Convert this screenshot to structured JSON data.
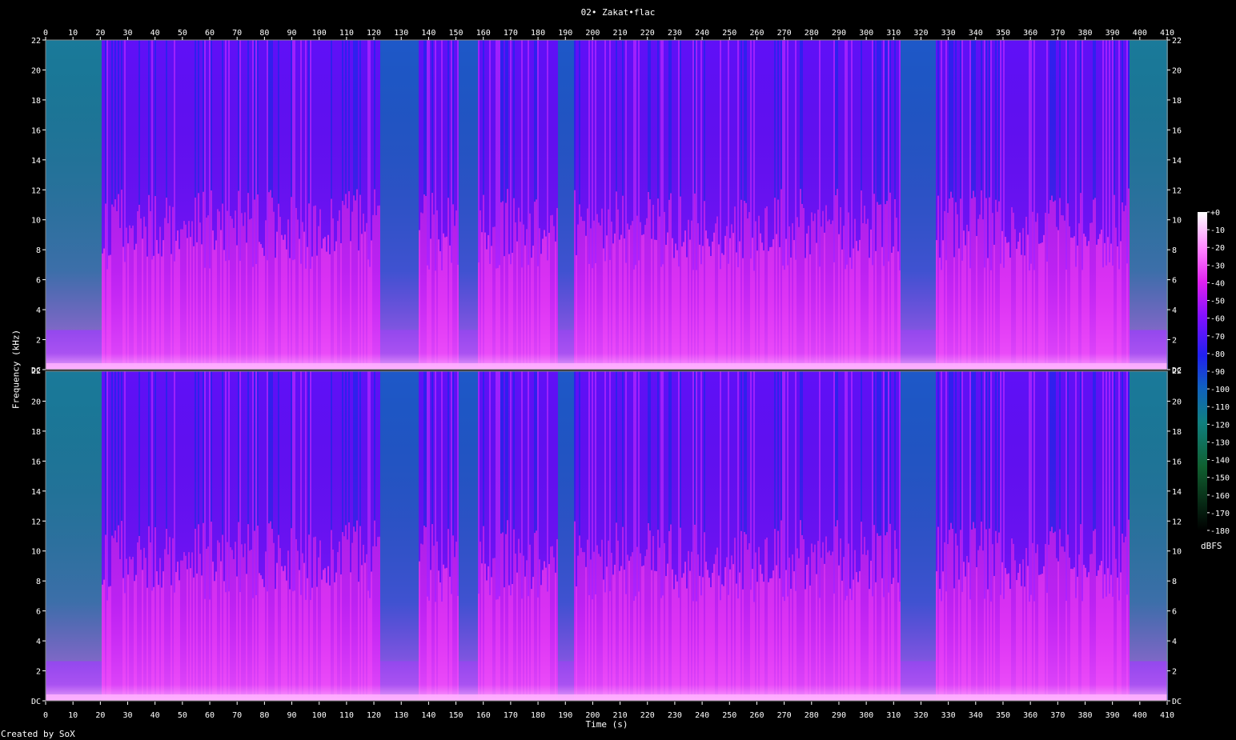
{
  "title": "02• Zakat•flac",
  "credit": "Created by SoX",
  "chart_data": {
    "type": "heatmap",
    "title": "02• Zakat•flac",
    "xlabel": "Time (s)",
    "ylabel": "Frequency (kHz)",
    "xlim": [
      0,
      410
    ],
    "ylim": [
      0,
      22
    ],
    "x_ticks": [
      "0",
      "10",
      "20",
      "30",
      "40",
      "50",
      "60",
      "70",
      "80",
      "90",
      "100",
      "110",
      "120",
      "130",
      "140",
      "150",
      "160",
      "170",
      "180",
      "190",
      "200",
      "210",
      "220",
      "230",
      "240",
      "250",
      "260",
      "270",
      "280",
      "290",
      "300",
      "310",
      "320",
      "330",
      "340",
      "350",
      "360",
      "370",
      "380",
      "390",
      "400",
      "410"
    ],
    "y_ticks": [
      "DC",
      "2",
      "4",
      "6",
      "8",
      "10",
      "12",
      "14",
      "16",
      "18",
      "20",
      "22"
    ],
    "channels": 2,
    "colorbar": {
      "unit": "dBFS",
      "range": [
        -180,
        0
      ],
      "ticks": [
        "+0",
        "-10",
        "-20",
        "-30",
        "-40",
        "-50",
        "-60",
        "-70",
        "-80",
        "-90",
        "-100",
        "-110",
        "-120",
        "-130",
        "-140",
        "-150",
        "-160",
        "-170",
        "-180"
      ]
    },
    "quiet_segments_s": [
      [
        0,
        20
      ],
      [
        122,
        136
      ],
      [
        151,
        158
      ],
      [
        187,
        193
      ],
      [
        312,
        325
      ],
      [
        396,
        410
      ]
    ],
    "colors": {
      "loud": "#ff40ff",
      "mid": "#8a10ff",
      "quiet": "#2828f0",
      "silent": "#1a7a9a"
    }
  }
}
